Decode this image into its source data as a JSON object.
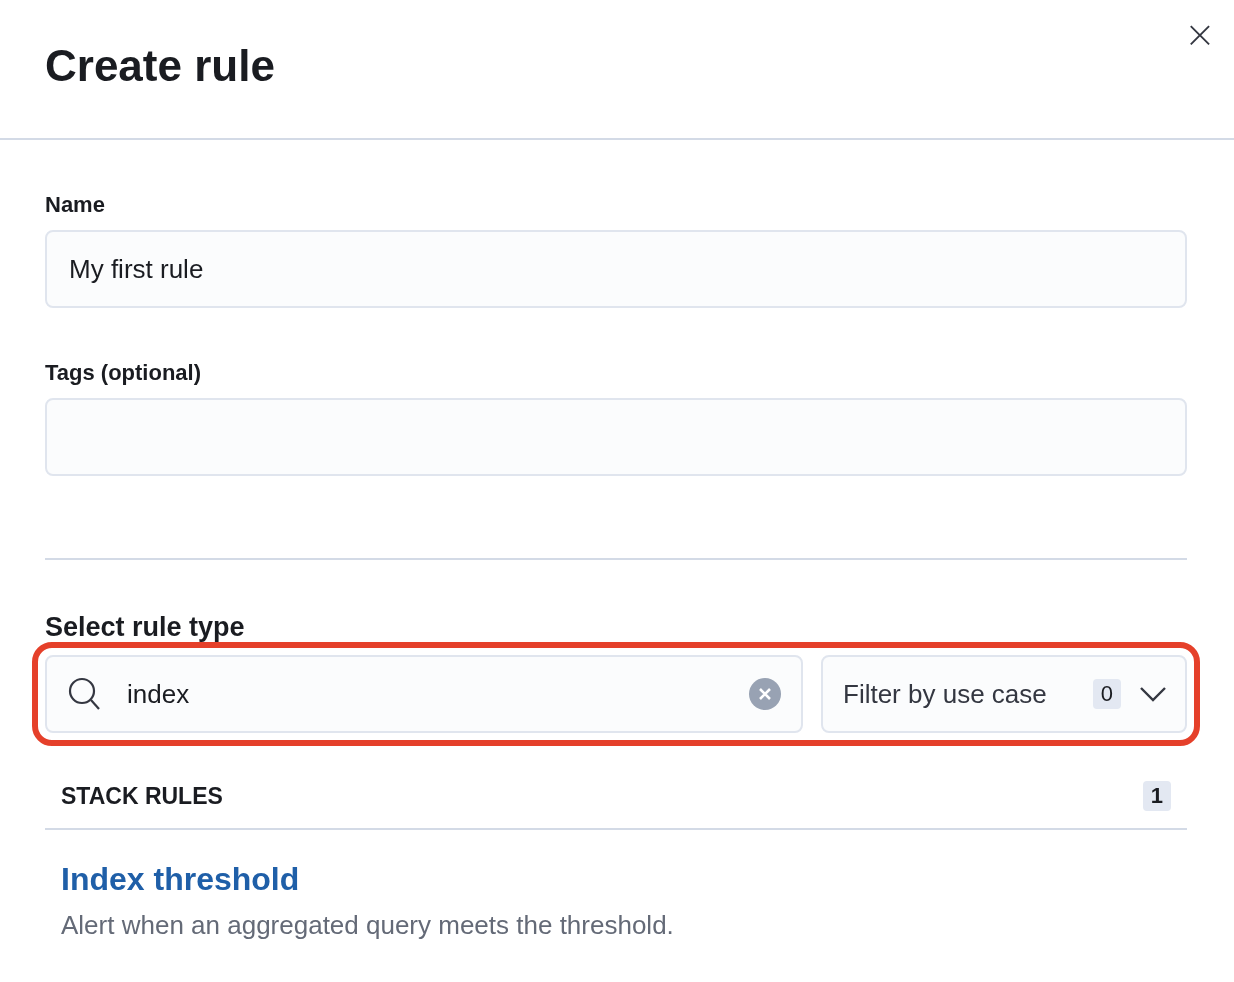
{
  "flyout": {
    "title": "Create rule",
    "close_label": "×"
  },
  "fields": [
    {
      "label": "Name",
      "value": "My first rule"
    },
    {
      "label": "Tags (optional)"
    }
  ],
  "rule_type": {
    "title": "Select rule type",
    "controls": {
      "highlighted": true,
      "search": {
        "value": "index"
      },
      "filter": {
        "label": "Filter by use case",
        "count": "0"
      }
    },
    "groups": [
      {
        "title": "STACK RULES",
        "count": "1",
        "rules": [
          {
            "title": "Index threshold",
            "description": "Alert when an aggregated query meets the threshold."
          }
        ]
      }
    ]
  }
}
